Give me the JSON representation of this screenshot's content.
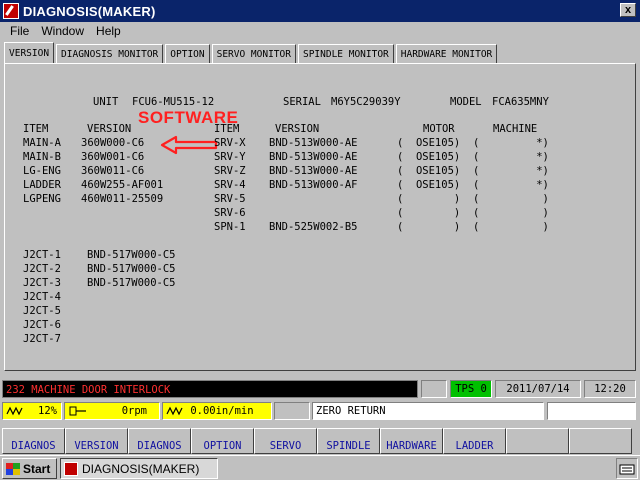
{
  "window": {
    "title": "DIAGNOSIS(MAKER)",
    "close_label": "x"
  },
  "menu": [
    "File",
    "Window",
    "Help"
  ],
  "tabs": [
    "VERSION",
    "DIAGNOSIS MONITOR",
    "OPTION",
    "SERVO MONITOR",
    "SPINDLE MONITOR",
    "HARDWARE MONITOR"
  ],
  "header": {
    "unit_label": "UNIT",
    "unit_value": "FCU6-MU515-12",
    "serial_label": "SERIAL",
    "serial_value": "M6Y5C29039Y",
    "model_label": "MODEL",
    "model_value": "FCA635MNY"
  },
  "annotation": {
    "software_label": "SOFTWARE"
  },
  "left_table": {
    "headers": [
      "ITEM",
      "VERSION"
    ],
    "rows": [
      [
        "MAIN-A",
        "360W000-C6"
      ],
      [
        "MAIN-B",
        "360W001-C6"
      ],
      [
        "LG-ENG",
        "360W011-C6"
      ],
      [
        "LADDER",
        "460W255-AF001"
      ],
      [
        "LGPENG",
        "460W011-25509"
      ]
    ]
  },
  "right_table": {
    "headers": [
      "ITEM",
      "VERSION",
      "MOTOR",
      "MACHINE"
    ],
    "rows": [
      [
        "SRV-X",
        "BND-513W000-AE",
        "(  OSE105)",
        "(         *)"
      ],
      [
        "SRV-Y",
        "BND-513W000-AE",
        "(  OSE105)",
        "(         *)"
      ],
      [
        "SRV-Z",
        "BND-513W000-AE",
        "(  OSE105)",
        "(         *)"
      ],
      [
        "SRV-4",
        "BND-513W000-AF",
        "(  OSE105)",
        "(         *)"
      ],
      [
        "SRV-5",
        "",
        "(        )",
        "(          )"
      ],
      [
        "SRV-6",
        "",
        "(        )",
        "(          )"
      ],
      [
        "SPN-1",
        "BND-525W002-B5",
        "(        )",
        "(          )"
      ]
    ]
  },
  "j2ct": [
    [
      "J2CT-1",
      "BND-517W000-C5"
    ],
    [
      "J2CT-2",
      "BND-517W000-C5"
    ],
    [
      "J2CT-3",
      "BND-517W000-C5"
    ],
    [
      "J2CT-4",
      ""
    ],
    [
      "J2CT-5",
      ""
    ],
    [
      "J2CT-6",
      ""
    ],
    [
      "J2CT-7",
      ""
    ]
  ],
  "status": {
    "alarm": "232 MACHINE DOOR INTERLOCK",
    "tps": "TPS 0",
    "date": "2011/07/14",
    "time": "12:20"
  },
  "feed": {
    "override": "12%",
    "spindle": "0rpm",
    "feedrate": "0.00in/min",
    "mode": "ZERO RETURN"
  },
  "softkeys": [
    "DIAGNOS",
    "VERSION",
    "DIAGNOS",
    "OPTION",
    "SERVO",
    "SPINDLE",
    "HARDWARE",
    "LADDER",
    "",
    ""
  ],
  "taskbar": {
    "start_label": "Start",
    "task_label": "DIAGNOSIS(MAKER)"
  },
  "colors": {
    "titlebar": "#0a246a",
    "alarm_text": "#ff3030",
    "tps_bg": "#00c000",
    "feed_bg": "#ffff00",
    "softkey_text": "#1010a0",
    "annotation": "#ff2020"
  }
}
